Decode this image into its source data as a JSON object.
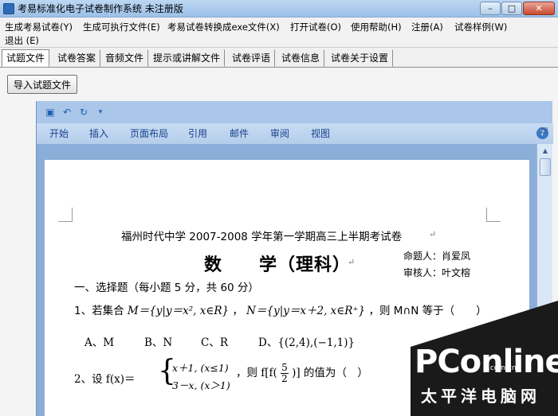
{
  "window": {
    "title": "考易标准化电子试卷制作系统  未注册版",
    "minimize": "–",
    "maximize": "□",
    "close": "✕"
  },
  "menu": [
    "生成考易试卷(Y)",
    "生成可执行文件(E)",
    "考易试卷转换成exe文件(X)",
    "打开试卷(O)",
    "使用帮助(H)",
    "注册(A)",
    "试卷样例(W)",
    "退出 (E)"
  ],
  "tabs": [
    "试题文件",
    "试卷答案",
    "音频文件",
    "提示或讲解文件",
    "试卷评语",
    "试卷信息",
    "试卷关于设置"
  ],
  "import_button": "导入试题文件",
  "word": {
    "ribbon_tabs": [
      "开始",
      "插入",
      "页面布局",
      "引用",
      "邮件",
      "审阅",
      "视图"
    ],
    "help": "?"
  },
  "doc": {
    "school_title": "福州时代中学 2007-2008 学年第一学期高三上半期考试卷",
    "subject": "数　　学（理科）",
    "setter": "命题人：肖爱凤",
    "reviewer": "审核人：叶文榕",
    "section": "一、选择题（每小题 5 分，共 60 分）",
    "q1_prefix": "1、若集合",
    "q1_set_m": "M＝{y|y＝x², x∈R}",
    "q1_sep": "，",
    "q1_set_n": "N＝{y|y＝x＋2, x∈R⁺}",
    "q1_suffix": "，则 M∩N 等于（　　）",
    "opt_a": "A、M",
    "opt_b": "B、N",
    "opt_c": "C、R",
    "opt_d": "D、{(2,4),(−1,1)}",
    "q2_prefix": "2、设 f(x)＝",
    "q2_case1": "x＋1, (x≤1)",
    "q2_case2": "3－x, (x＞1)",
    "q2_mid": "，则 f[f(",
    "q2_num": "5",
    "q2_den": "2",
    "q2_suffix": ")] 的值为（　）",
    "para_mark": "↵"
  },
  "watermark": {
    "logo": "PConline",
    "dotcn": ".com.cn",
    "sub": "太平洋电脑网"
  }
}
